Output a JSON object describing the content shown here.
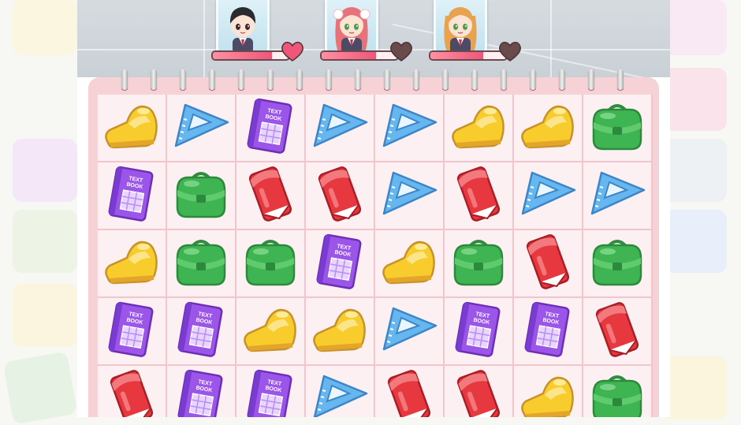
{
  "colors": {
    "board_background": "#fbe9ec",
    "grid_line": "#f0c5cc",
    "shoe": "#f7cc2c",
    "ruler": "#66b6f0",
    "textbook": "#9b55e8",
    "backpack": "#3fb452",
    "eraser": "#e8383f"
  },
  "characters": [
    {
      "name": "dark-haired-boy",
      "hair": "#2b2a30",
      "hp": 0.78
    },
    {
      "name": "pink-haired-girl",
      "hair": "#e8727a",
      "hp": 0.72
    },
    {
      "name": "orange-haired-girl",
      "hair": "#e9a24f",
      "hp": 0.7
    }
  ],
  "tiles": {
    "textbook_label_line1": "TEXT",
    "textbook_label_line2": "BOOK"
  },
  "board": [
    [
      "shoe",
      "ruler",
      "textbook",
      "ruler",
      "ruler",
      "shoe",
      "shoe",
      "backpack"
    ],
    [
      "textbook",
      "backpack",
      "eraser",
      "eraser",
      "ruler",
      "eraser",
      "ruler",
      "ruler"
    ],
    [
      "shoe",
      "backpack",
      "backpack",
      "textbook",
      "shoe",
      "backpack",
      "eraser",
      "backpack"
    ],
    [
      "textbook",
      "textbook",
      "shoe",
      "shoe",
      "ruler",
      "textbook",
      "textbook",
      "eraser"
    ],
    [
      "eraser",
      "textbook",
      "textbook",
      "ruler",
      "eraser",
      "eraser",
      "shoe",
      "backpack"
    ]
  ]
}
